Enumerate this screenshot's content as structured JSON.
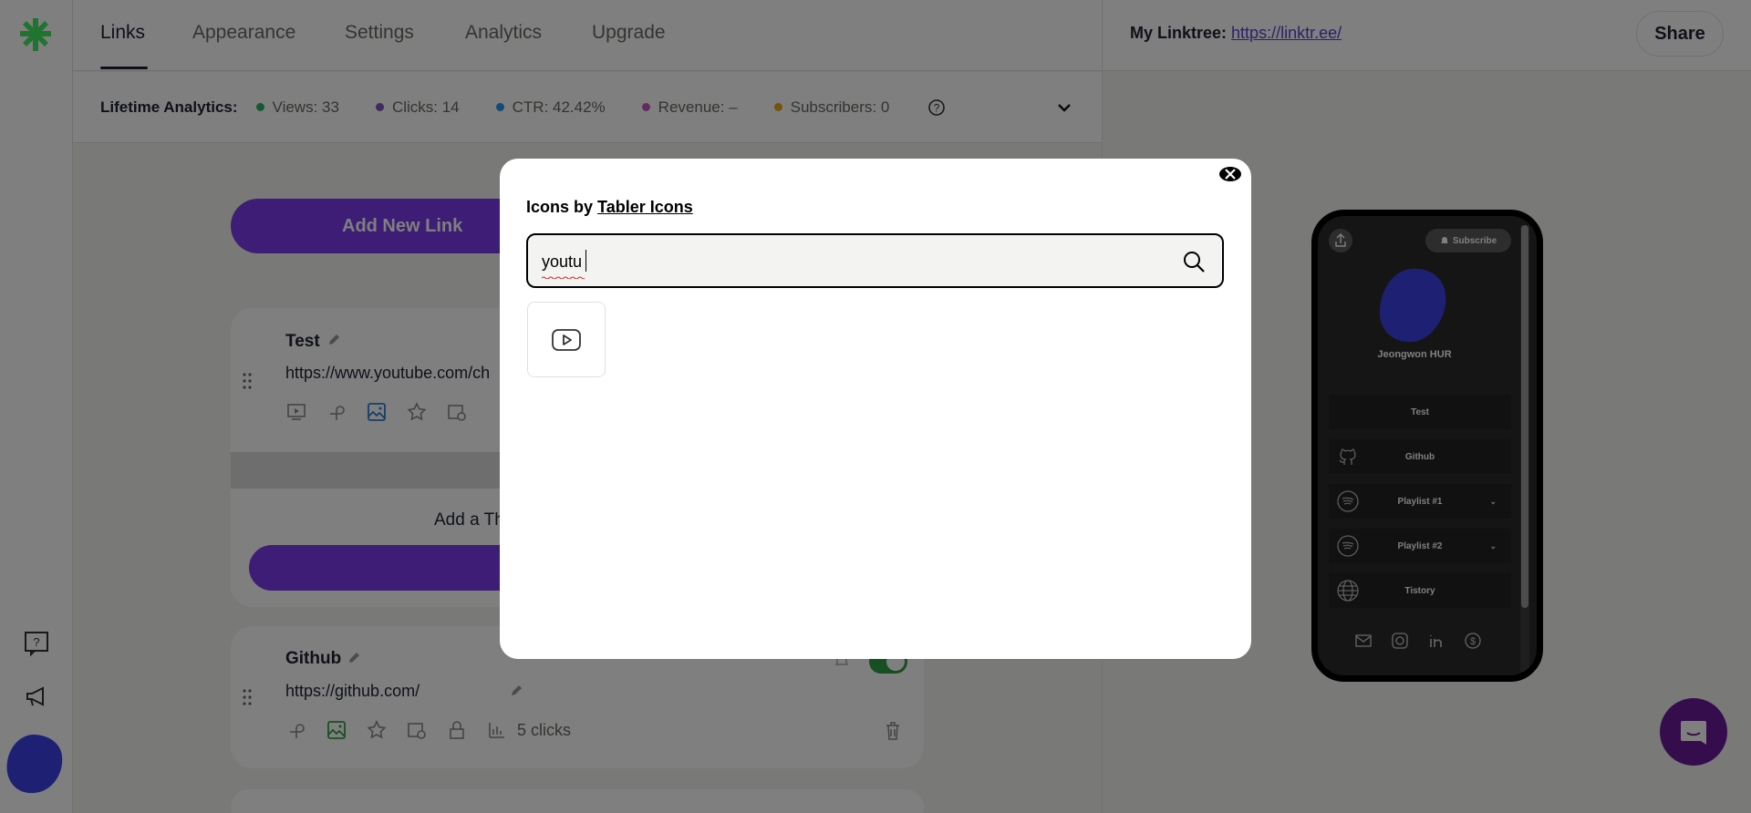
{
  "nav": {
    "tabs": [
      {
        "label": "Links",
        "active": true
      },
      {
        "label": "Appearance"
      },
      {
        "label": "Settings"
      },
      {
        "label": "Analytics"
      },
      {
        "label": "Upgrade"
      }
    ]
  },
  "analytics": {
    "label": "Lifetime Analytics:",
    "metrics": [
      {
        "text": "Views: 33",
        "color": "#28b463"
      },
      {
        "text": "Clicks: 14",
        "color": "#7e57c2"
      },
      {
        "text": "CTR: 42.42%",
        "color": "#2196f3"
      },
      {
        "text": "Revenue: –",
        "color": "#c653c6"
      },
      {
        "text": "Subscribers: 0",
        "color": "#e6a817"
      }
    ]
  },
  "header": {
    "mylinktree_label": "My Linktree:",
    "mylinktree_url": "https://linktr.ee/",
    "share_label": "Share"
  },
  "editor": {
    "add_link_label": "Add New Link",
    "links": [
      {
        "title": "Test",
        "url": "https://www.youtube.com/ch"
      },
      {
        "title": "Github",
        "url": "https://github.com/",
        "clicks": "5 clicks"
      }
    ],
    "thumbnail_label": "Add a Th"
  },
  "preview": {
    "subscribe_label": "Subscribe",
    "profile_name": "Jeongwon HUR",
    "buttons": [
      {
        "label": "Test",
        "icon": "none"
      },
      {
        "label": "Github",
        "icon": "github-icon"
      },
      {
        "label": "Playlist #1",
        "icon": "spotify-icon",
        "chevron": true
      },
      {
        "label": "Playlist #2",
        "icon": "spotify-icon",
        "chevron": true
      },
      {
        "label": "Tistory",
        "icon": "globe-icon"
      }
    ],
    "socials": [
      "mail-icon",
      "instagram-icon",
      "linkedin-icon",
      "dollar-icon"
    ]
  },
  "modal": {
    "heading_prefix": "Icons by",
    "heading_link": "Tabler Icons",
    "search_value": "youtu",
    "results": [
      "youtube-icon"
    ]
  },
  "colors": {
    "accent": "#7c3aed",
    "logo": "#43e660",
    "avatar": "#3d43e6",
    "toggle": "#2f9e44",
    "chat": "#6a1b9a"
  }
}
